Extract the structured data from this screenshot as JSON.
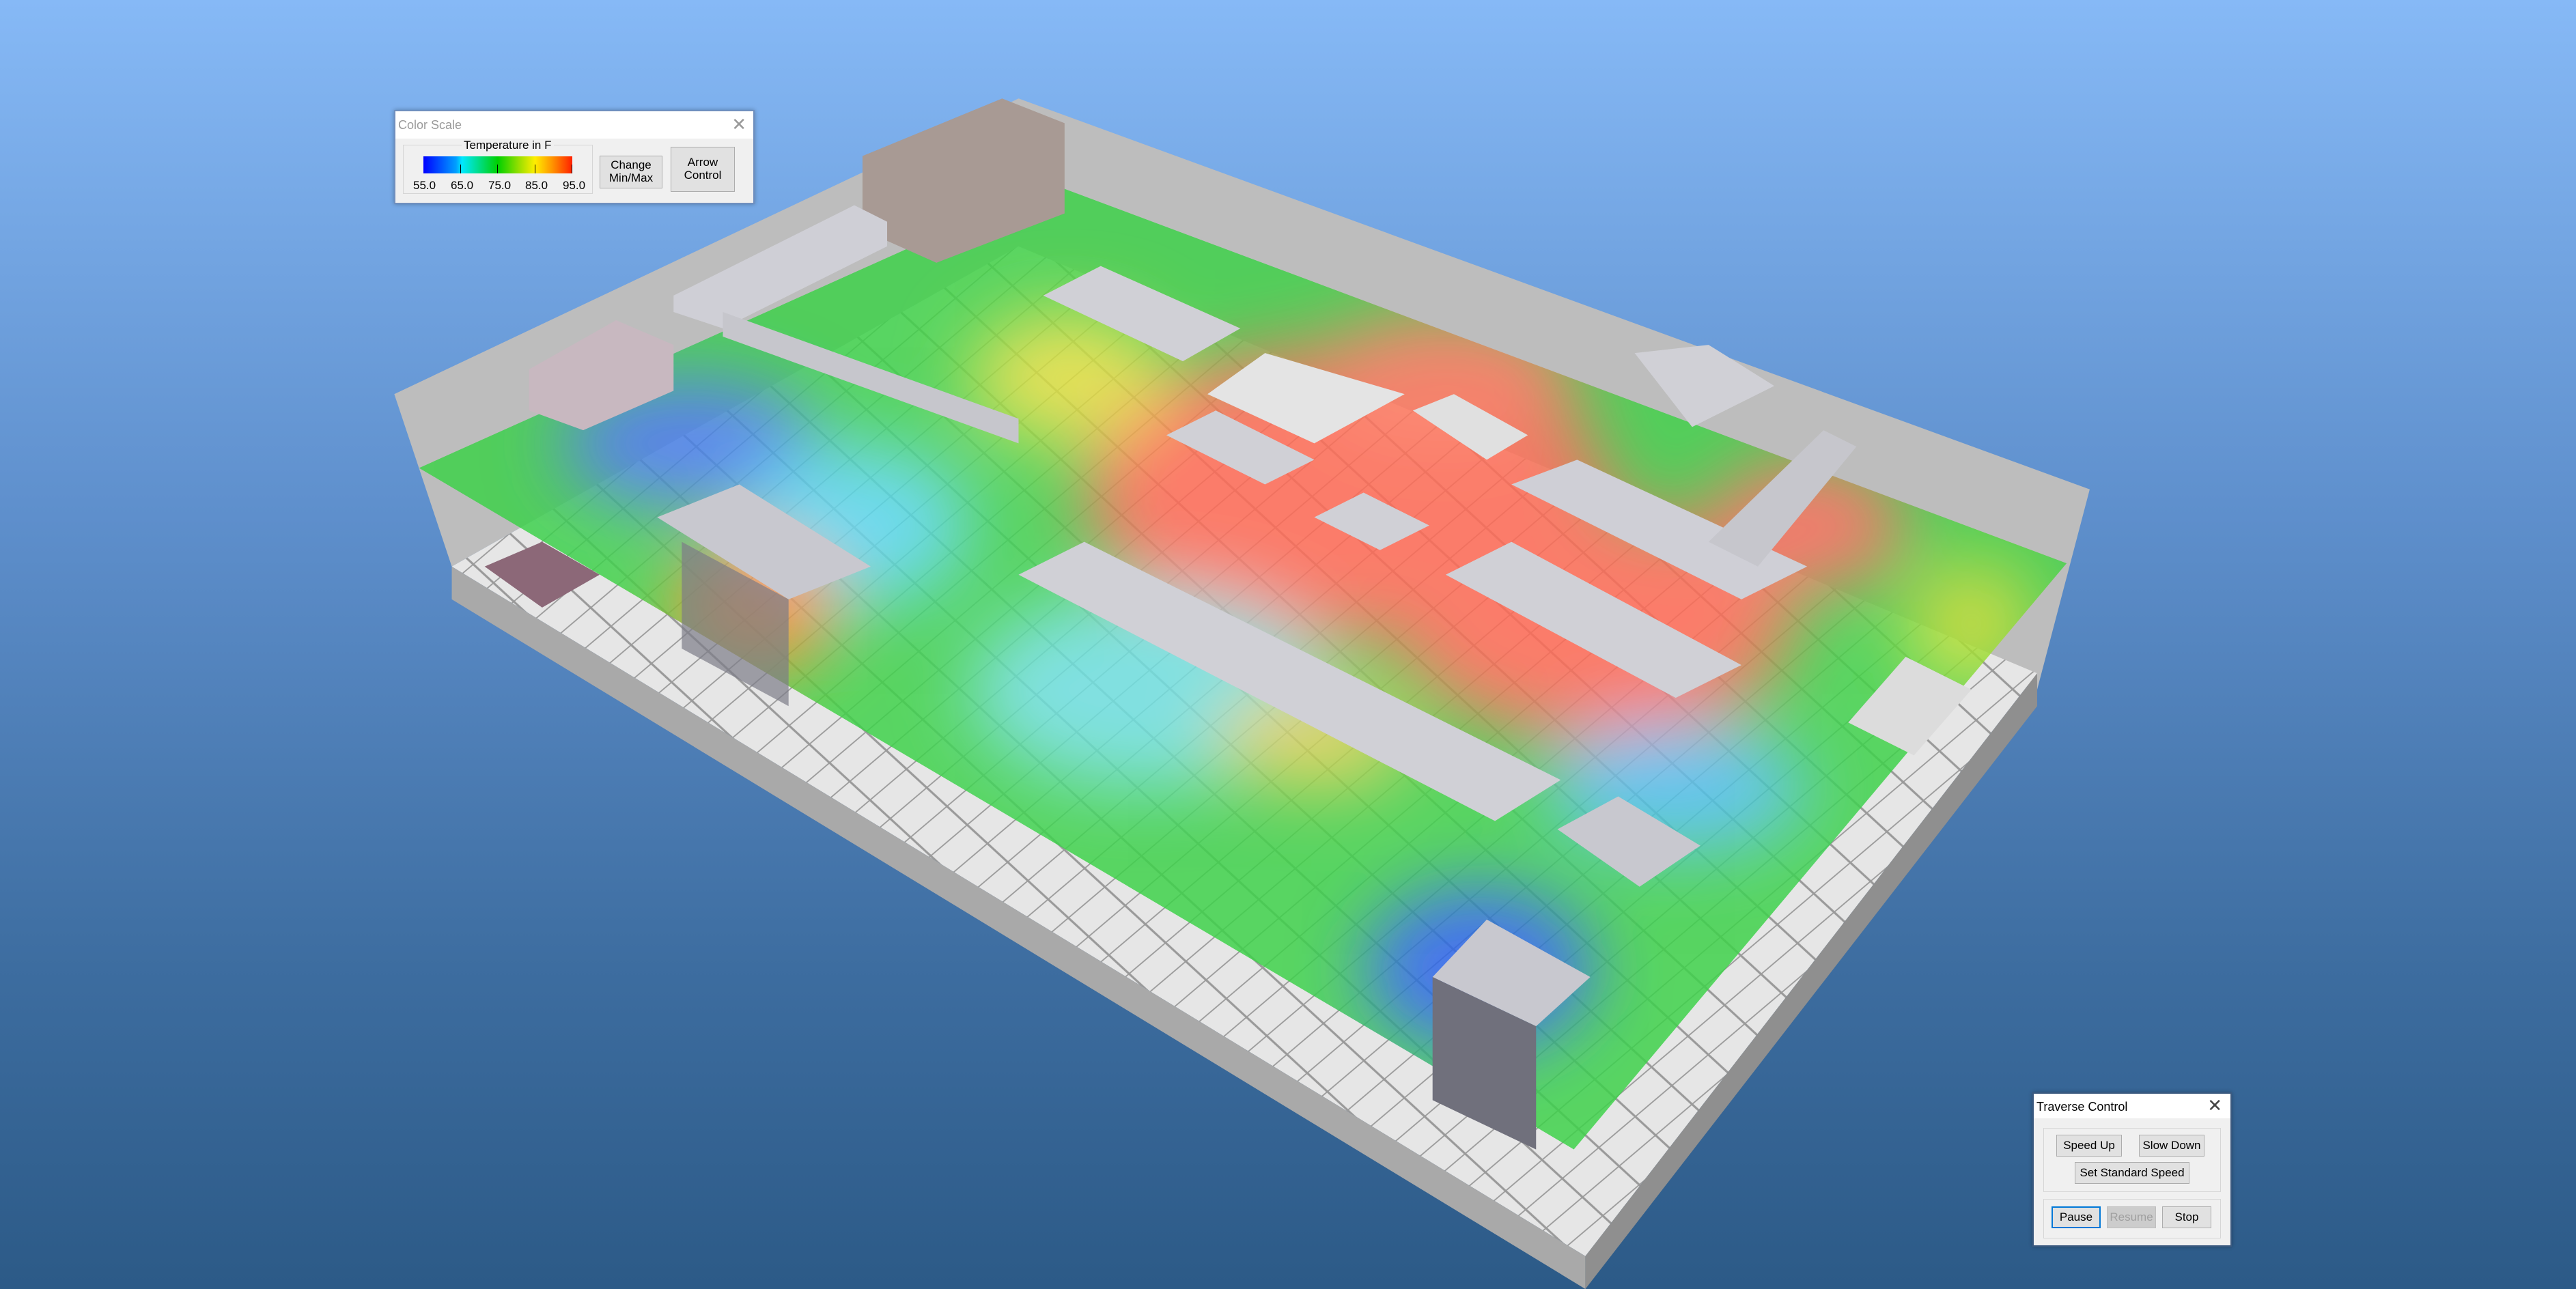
{
  "color_scale": {
    "title": "Color Scale",
    "legend_title": "Temperature in F",
    "tick_labels": [
      "55.0",
      "65.0",
      "75.0",
      "85.0",
      "95.0"
    ],
    "gradient_colors": [
      "#0000ff",
      "#00e5ff",
      "#00d000",
      "#ffee00",
      "#ff2000"
    ],
    "change_minmax_label": "Change\nMin/Max",
    "arrow_control_label": "Arrow\nControl"
  },
  "traverse_control": {
    "title": "Traverse Control",
    "speed_up_label": "Speed Up",
    "slow_down_label": "Slow Down",
    "standard_speed_label": "Set Standard Speed",
    "pause_label": "Pause",
    "resume_label": "Resume",
    "stop_label": "Stop",
    "resume_enabled": false
  }
}
